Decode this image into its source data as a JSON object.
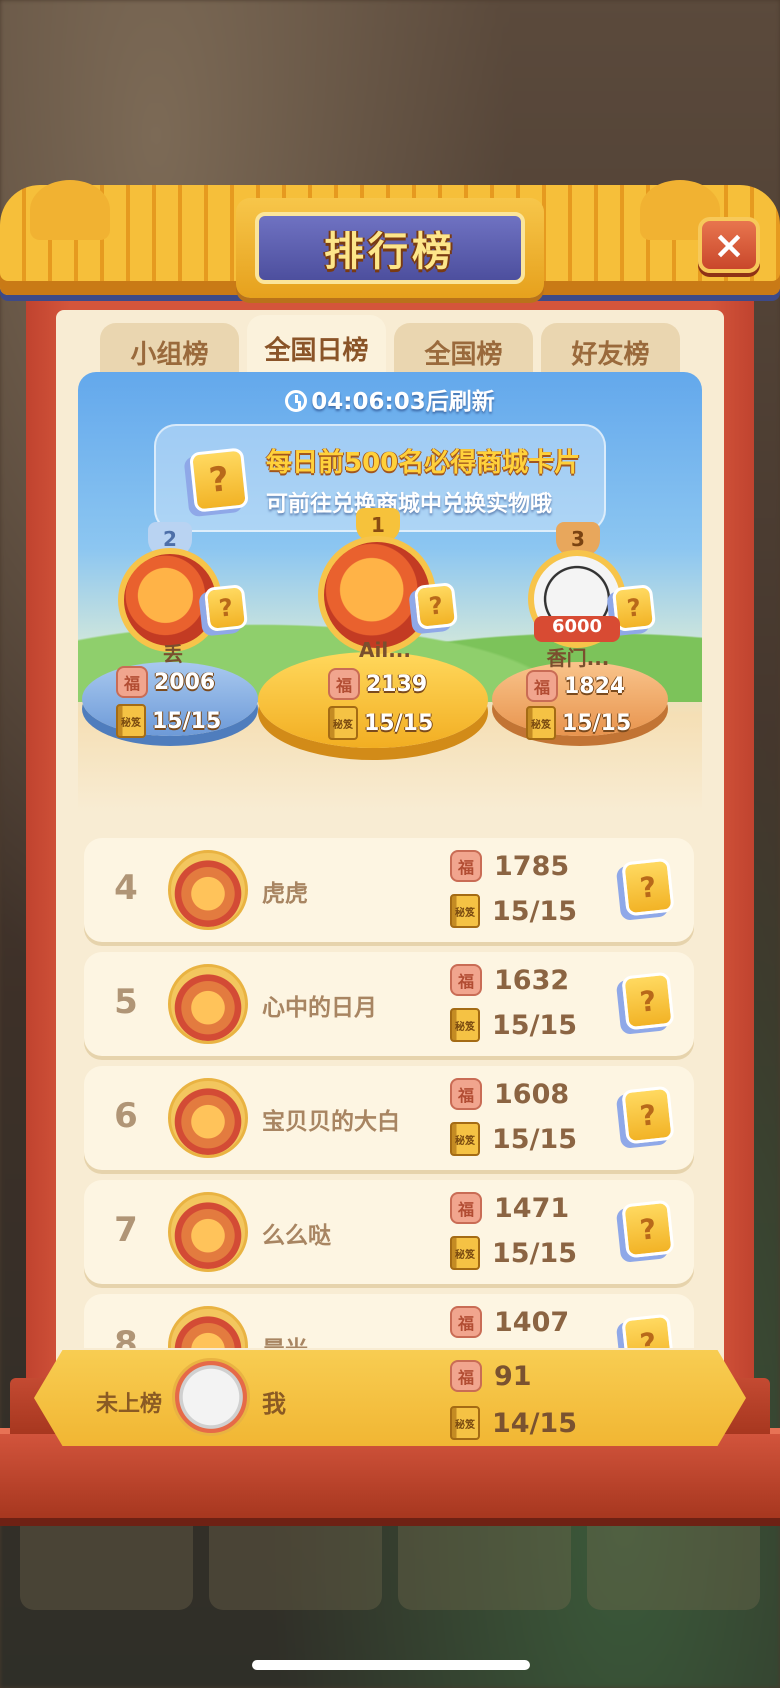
{
  "title": "排行榜",
  "close_label": "×",
  "tabs": [
    {
      "label": "小组榜",
      "active": false
    },
    {
      "label": "全国日榜",
      "active": true
    },
    {
      "label": "全国榜",
      "active": false
    },
    {
      "label": "好友榜",
      "active": false
    }
  ],
  "refresh_text": "04:06:03后刷新",
  "promo": {
    "line1": "每日前500名必得商城卡片",
    "line2": "可前往兑换商城中兑换实物哦",
    "card_symbol": "?"
  },
  "podium": [
    {
      "rank": "2",
      "name": "丢",
      "score": "2006",
      "progress": "15/15"
    },
    {
      "rank": "1",
      "name": "Ail...",
      "score": "2139",
      "progress": "15/15"
    },
    {
      "rank": "3",
      "name": "香门...",
      "score": "1824",
      "progress": "15/15",
      "badge": "6000"
    }
  ],
  "fu_symbol": "福",
  "book_symbol": "秘笈",
  "list": [
    {
      "rank": "4",
      "name": "虎虎",
      "score": "1785",
      "progress": "15/15"
    },
    {
      "rank": "5",
      "name": "心中的日月",
      "score": "1632",
      "progress": "15/15"
    },
    {
      "rank": "6",
      "name": "宝贝贝的大白",
      "score": "1608",
      "progress": "15/15"
    },
    {
      "rank": "7",
      "name": "么么哒",
      "score": "1471",
      "progress": "15/15"
    },
    {
      "rank": "8",
      "name": "晨光",
      "score": "1407",
      "progress": ""
    }
  ],
  "me": {
    "status": "未上榜",
    "name": "我",
    "score": "91",
    "progress": "14/15"
  },
  "colors": {
    "frame": "#d4553b",
    "panel": "#f8ecd3",
    "title_bg": "#4d4f9e",
    "gold": "#f1b633"
  }
}
